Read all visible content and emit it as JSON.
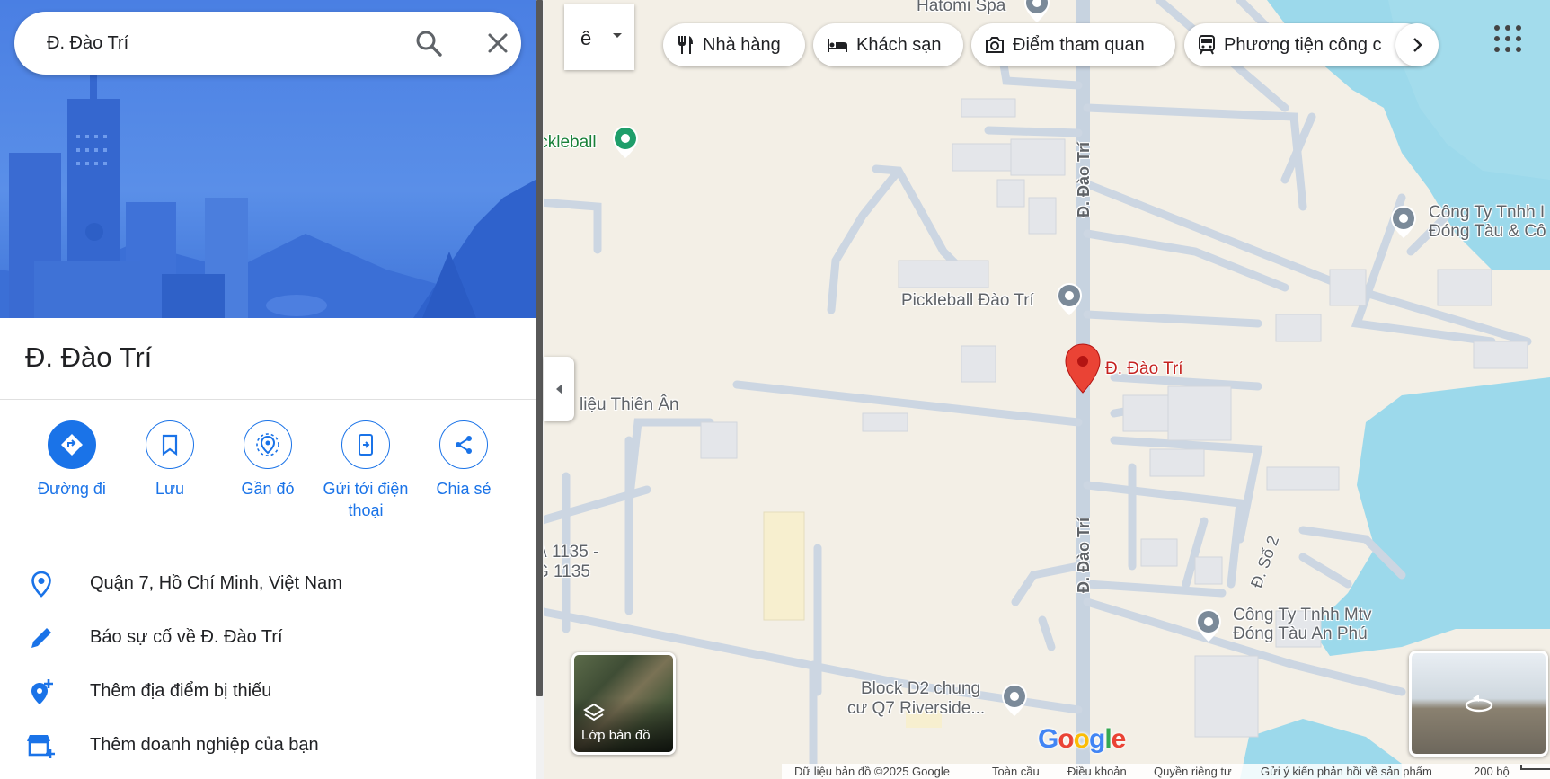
{
  "search": {
    "value": "Đ. Đào Trí"
  },
  "place": {
    "title": "Đ. Đào Trí"
  },
  "actions": [
    {
      "label": "Đường đi"
    },
    {
      "label": "Lưu"
    },
    {
      "label": "Gần đó"
    },
    {
      "label": "Gửi tới điện thoại"
    },
    {
      "label": "Chia sẻ"
    }
  ],
  "info": [
    {
      "text": "Quận 7, Hồ Chí Minh, Việt Nam",
      "icon": "location-pin-icon"
    },
    {
      "text": "Báo sự cố về Đ. Đào Trí",
      "icon": "pencil-icon"
    },
    {
      "text": "Thêm địa điểm bị thiếu",
      "icon": "add-location-icon"
    },
    {
      "text": "Thêm doanh nghiệp của bạn",
      "icon": "add-business-icon"
    }
  ],
  "language": {
    "value": "ê"
  },
  "chips": [
    {
      "label": "Nhà hàng",
      "icon": "restaurant-icon"
    },
    {
      "label": "Khách sạn",
      "icon": "hotel-icon"
    },
    {
      "label": "Điểm tham quan",
      "icon": "camera-icon"
    },
    {
      "label": "Phương tiện công c",
      "icon": "transit-icon"
    }
  ],
  "map": {
    "labels": {
      "hatomi": "Hatomi Spa",
      "pickleball1": "ickleball",
      "pickleball2": "Pickleball Đào Trí",
      "dao_tri": "Đ. Đào Trí",
      "thien_an": "liệu Thiên Ân",
      "a1135_1": "À 1135 -",
      "a1135_2": "G 1135",
      "cty1_1": "Công Ty Tnhh I",
      "cty1_2": "Đóng Tàu & Cô",
      "cty2_1": "Công Ty Tnhh Mtv",
      "cty2_2": "Đóng Tàu An Phú",
      "block1": "Block D2 chung",
      "block2": "cư Q7 Riverside...",
      "road_dao_tri_1": "Đ. Đào Trí",
      "road_dao_tri_2": "Đ. Đào Trí",
      "road_so2": "Đ. Số 2"
    },
    "layer_label": "Lớp bản đồ",
    "google": "Google"
  },
  "footer": {
    "data": "Dữ liệu bản đồ ©2025 Google",
    "global": "Toàn cầu",
    "terms": "Điều khoản",
    "privacy": "Quyền riêng tư",
    "feedback": "Gửi ý kiến phản hồi về sản phẩm",
    "scale": "200 bộ"
  },
  "colors": {
    "accent": "#1a73e8",
    "water": "#9cd9eb",
    "road": "#c7d3e0",
    "pin": "#ea4335"
  }
}
